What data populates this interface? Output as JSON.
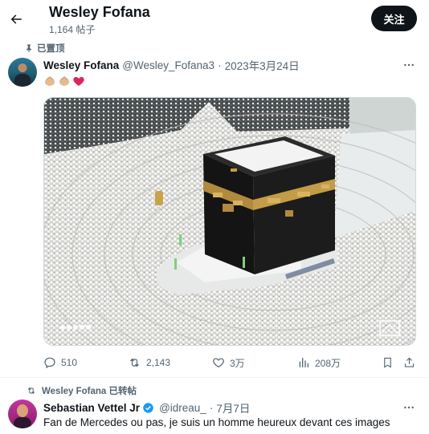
{
  "header": {
    "title": "Wesley Fofana",
    "post_count": "1,164 帖子",
    "follow_label": "关注"
  },
  "pinned_tweet": {
    "pinned_label": "已置顶",
    "author_name": "Wesley Fofana",
    "handle": "@Wesley_Fofana3",
    "separator": "·",
    "date": "2023年3月24日",
    "emojis": [
      "hands-icon",
      "hands-icon",
      "red-heart-icon"
    ],
    "stats": {
      "replies": "510",
      "retweets": "2,143",
      "likes": "3万",
      "views": "208万"
    }
  },
  "retweet": {
    "retweeted_by": "Wesley Fofana 已转帖",
    "author_name": "Sebastian Vettel Jr",
    "handle": "@idreau_",
    "separator": "·",
    "date": "7月7日",
    "text": "Fan de Mercedes ou pas, je suis un homme heureux devant ces images"
  },
  "colors": {
    "text_primary": "#0f1419",
    "text_secondary": "#536471",
    "heart": "#e0245e",
    "verified": "#1d9bf0",
    "follow_bg": "#0f1419"
  }
}
